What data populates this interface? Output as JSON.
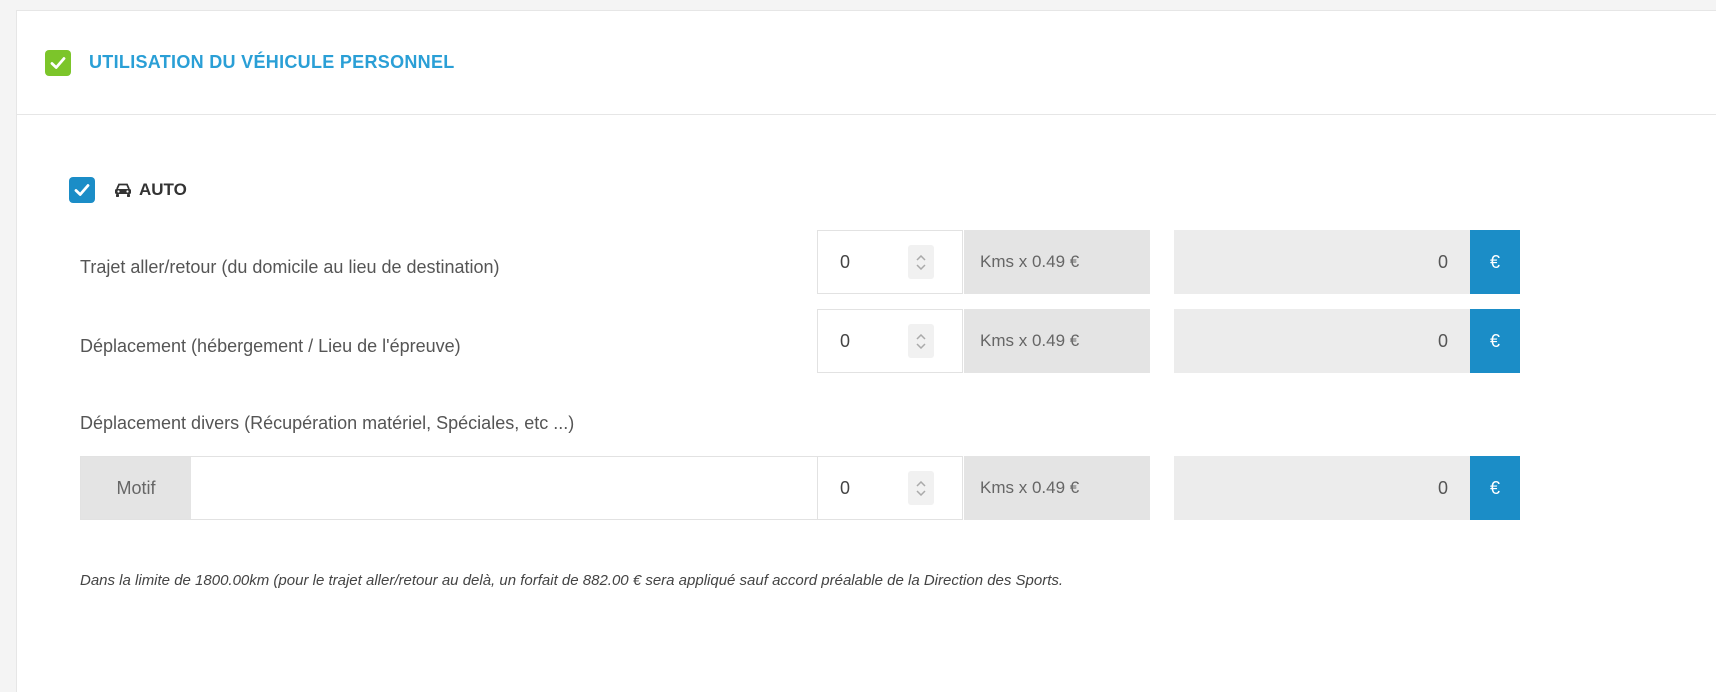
{
  "section": {
    "title": "UTILISATION DU VÉHICULE PERSONNEL",
    "checked": true,
    "accent_color": "#7cc52a",
    "title_color": "#2a9fd6"
  },
  "auto": {
    "label": "AUTO",
    "checked": true,
    "icon": "car-icon"
  },
  "rows": [
    {
      "label": "Trajet aller/retour (du domicile au lieu de destination)",
      "kms_value": "0",
      "rate_label": "Kms x 0.49 €",
      "total": "0",
      "currency": "€"
    },
    {
      "label": "Déplacement (hébergement / Lieu de l'épreuve)",
      "kms_value": "0",
      "rate_label": "Kms x 0.49 €",
      "total": "0",
      "currency": "€"
    },
    {
      "label": "Déplacement divers (Récupération matériel, Spéciales, etc ...)",
      "motif_label": "Motif",
      "motif_value": "",
      "kms_value": "0",
      "rate_label": "Kms x 0.49 €",
      "total": "0",
      "currency": "€"
    }
  ],
  "footnote": "Dans la limite de 1800.00km (pour le trajet aller/retour au delà, un forfait de 882.00 € sera appliqué sauf accord préalable de la Direction des Sports."
}
